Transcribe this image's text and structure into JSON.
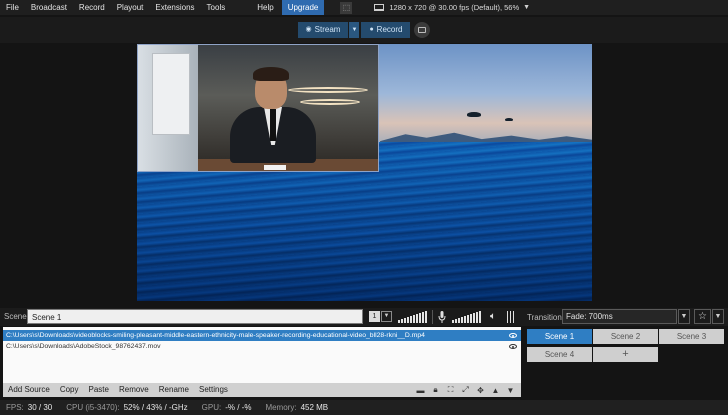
{
  "menu": {
    "items": [
      "File",
      "Broadcast",
      "Record",
      "Playout",
      "Extensions",
      "Tools",
      "Help"
    ],
    "upgrade": "Upgrade",
    "resolution": "1280 x 720 @ 30.00 fps (Default), 56%"
  },
  "streambar": {
    "stream_label": "Stream",
    "record_label": "Record"
  },
  "scene": {
    "label": "Scene",
    "name": "Scene 1",
    "number": "1"
  },
  "transition": {
    "label": "Transition",
    "value": "Fade: 700ms"
  },
  "scenes": [
    "Scene 1",
    "Scene 2",
    "Scene 3",
    "Scene 4"
  ],
  "add_scene": "+",
  "sources": [
    {
      "path": "C:\\Users\\s\\Downloads\\videoblocks-smiling-pleasant-middle-eastern-ethnicity-male-speaker-recording-educational-video_bll28-rkni__D.mp4",
      "selected": true
    },
    {
      "path": "C:\\Users\\s\\Downloads\\AdobeStock_98762437.mov",
      "selected": false
    }
  ],
  "source_actions": [
    "Add Source",
    "Copy",
    "Paste",
    "Remove",
    "Rename",
    "Settings"
  ],
  "status": {
    "fps_label": "FPS:",
    "fps_value": "30 / 30",
    "cpu_label": "CPU (i5-3470):",
    "cpu_value": "52% / 43% / -GHz",
    "gpu_label": "GPU:",
    "gpu_value": "-% / -%",
    "memory_label": "Memory:",
    "memory_value": "452 MB"
  },
  "colors": {
    "accent": "#2f7ec3",
    "upgrade": "#2f6bb0",
    "stream_pill": "#244b6e"
  }
}
